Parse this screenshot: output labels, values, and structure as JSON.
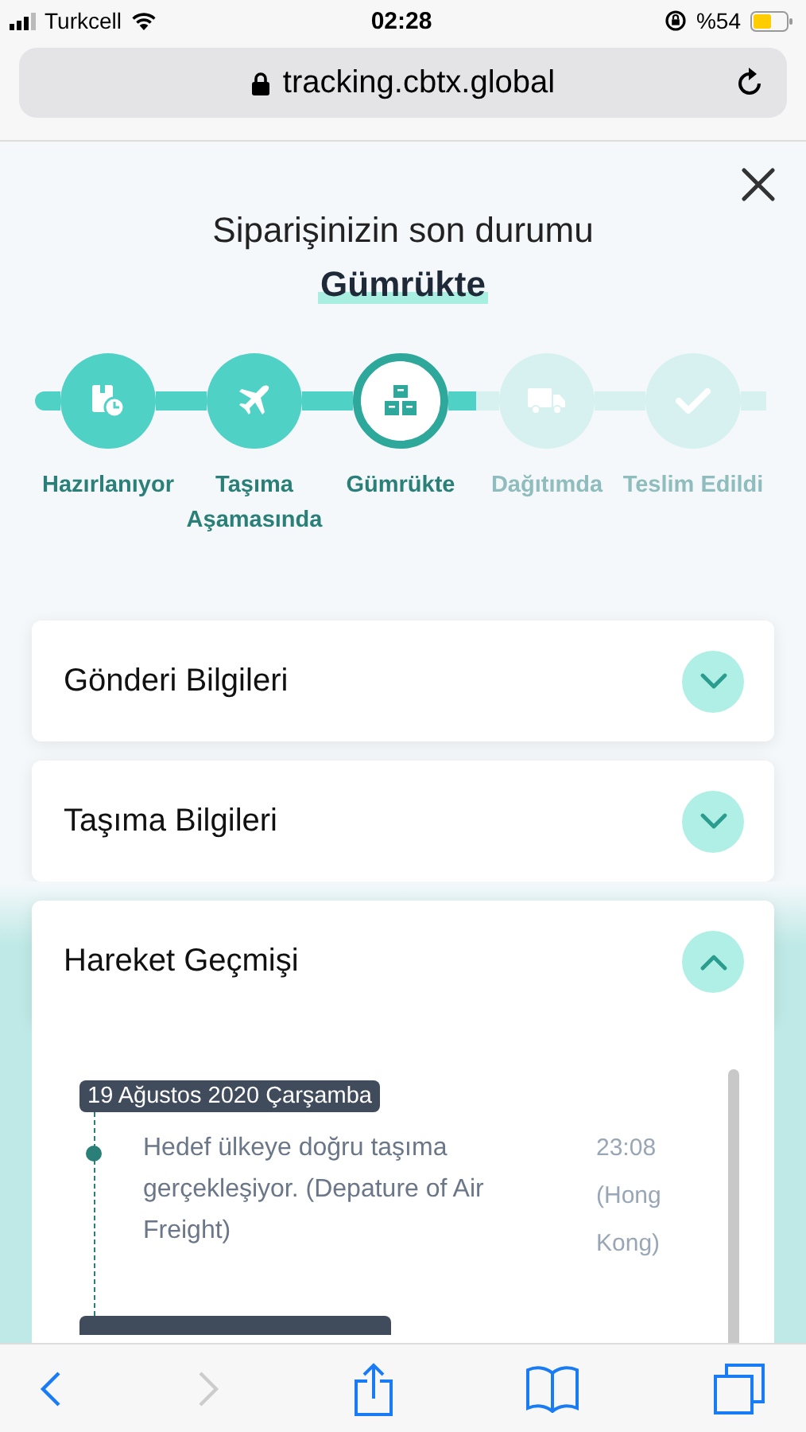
{
  "status_bar": {
    "carrier": "Turkcell",
    "time": "02:28",
    "battery": "%54"
  },
  "browser": {
    "url": "tracking.cbtx.global"
  },
  "heading": {
    "title": "Siparişinizin son durumu",
    "status": "Gümrükte"
  },
  "steps": [
    {
      "label": "Hazırlanıyor",
      "done": true,
      "selected": false
    },
    {
      "label": "Taşıma Aşamasında",
      "done": true,
      "selected": false
    },
    {
      "label": "Gümrükte",
      "done": false,
      "selected": true
    },
    {
      "label": "Dağıtımda",
      "done": false,
      "selected": false
    },
    {
      "label": "Teslim Edildi",
      "done": false,
      "selected": false
    }
  ],
  "sections": [
    {
      "title": "Gönderi Bilgileri",
      "expanded": false
    },
    {
      "title": "Taşıma Bilgileri",
      "expanded": false
    },
    {
      "title": "Hareket Geçmişi",
      "expanded": true
    }
  ],
  "history": [
    {
      "date": "19 Ağustos 2020 Çarşamba",
      "events": [
        {
          "text": "Hedef ülkeye doğru taşıma gerçekleşiyor. (Depature of Air Freight)",
          "time": "23:08",
          "place": "(Hong Kong)"
        }
      ]
    }
  ],
  "toolbar": {
    "back_disabled": false,
    "forward_disabled": true
  }
}
